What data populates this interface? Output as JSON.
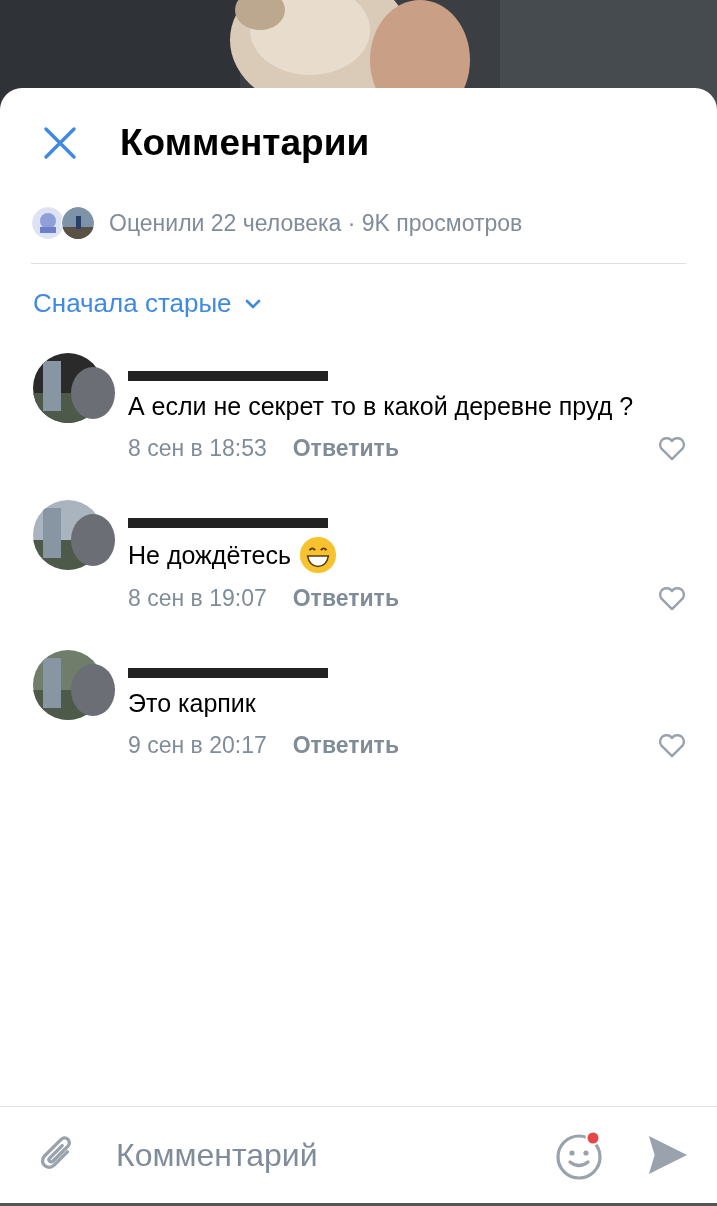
{
  "header": {
    "title": "Комментарии"
  },
  "likes": {
    "text": "Оценили 22 человека · 9K просмотров"
  },
  "sort": {
    "label": "Сначала старые"
  },
  "comments": [
    {
      "text": "А если не секрет то в какой деревне пруд ?",
      "emoji": false,
      "time": "8 сен в 18:53",
      "reply": "Ответить",
      "liked": false
    },
    {
      "text": "Не дождётесь",
      "emoji": true,
      "time": "8 сен в 19:07",
      "reply": "Ответить",
      "liked": false
    },
    {
      "text": "Это карпик",
      "emoji": false,
      "time": "9 сен в 20:17",
      "reply": "Ответить",
      "liked": false
    }
  ],
  "composer": {
    "placeholder": "Комментарий",
    "emoji_badge": true
  }
}
